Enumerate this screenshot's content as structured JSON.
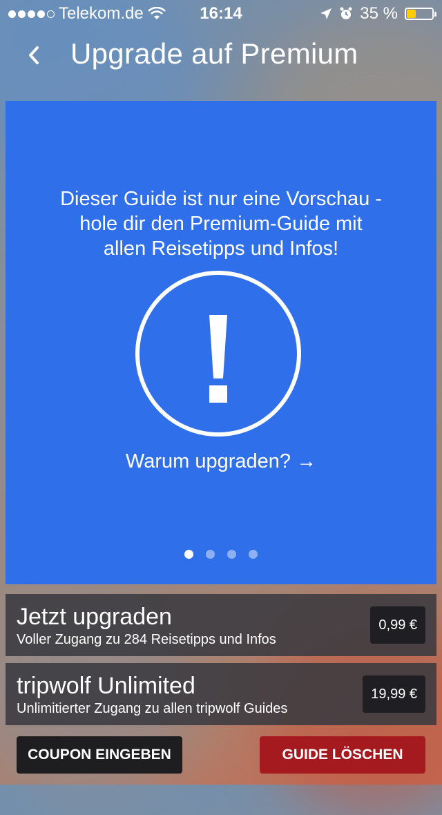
{
  "status_bar": {
    "carrier": "Telekom.de",
    "time": "16:14",
    "battery_percent": "35 %",
    "battery_level": 0.35,
    "icons": [
      "signal-dots",
      "wifi-icon",
      "location-arrow-icon",
      "alarm-clock-icon",
      "battery-icon"
    ]
  },
  "nav": {
    "title": "Upgrade auf Premium",
    "back_icon": "chevron-left-icon"
  },
  "promo": {
    "message": "Dieser Guide ist nur eine Vorschau -\nhole dir den Premium-Guide mit\nallen Reisetipps und Infos!",
    "icon": "exclamation-circle-icon",
    "link_text": "Warum upgraden? →",
    "page_count": 4,
    "current_page": 1
  },
  "offers": [
    {
      "title": "Jetzt upgraden",
      "subtitle": "Voller Zugang zu 284 Reisetipps und Infos",
      "price": "0,99 €"
    },
    {
      "title": "tripwolf Unlimited",
      "subtitle": "Unlimitierter Zugang zu allen tripwolf Guides",
      "price": "19,99 €"
    }
  ],
  "actions": {
    "coupon_label": "COUPON EINGEBEN",
    "delete_label": "GUIDE LÖSCHEN"
  },
  "colors": {
    "card_blue": "#2f6fe9",
    "delete_red": "#a51a1f",
    "battery_yellow": "#ffcc00"
  }
}
